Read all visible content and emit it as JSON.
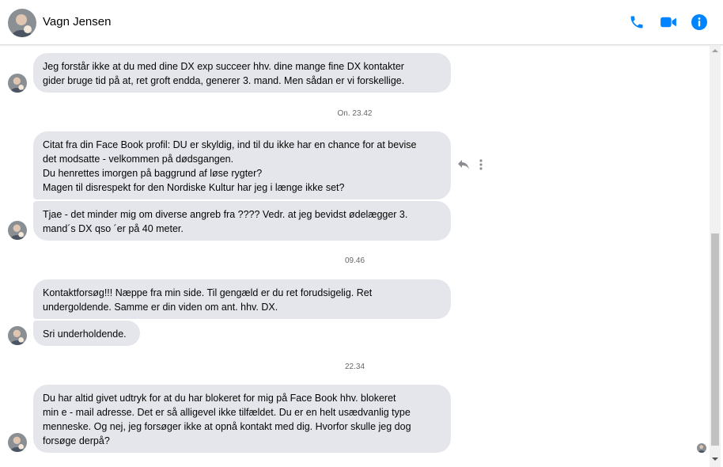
{
  "contact": {
    "name": "Vagn Jensen"
  },
  "header_icons": [
    "phone-icon",
    "video-camera-icon",
    "info-icon"
  ],
  "colors": {
    "accent": "#0084ff",
    "bubble": "#e4e6eb",
    "timestamp": "#65676b"
  },
  "messages": [
    {
      "text": "Jeg forstår ikke at du med dine DX exp succeer hhv. dine mange fine DX kontakter\ngider bruge tid på at, ret groft endda, generer 3. mand. Men sådan er vi forskellige."
    },
    {
      "text": "Citat fra din Face Book profil: DU er skyldig, ind til du ikke har en chance for at bevise\ndet modsatte - velkommen på dødsgangen.\nDu henrettes imorgen på baggrund af løse rygter?\nMagen til disrespekt for den Nordiske Kultur har jeg i længe ikke set?"
    },
    {
      "text": "Tjae - det minder mig om diverse angreb fra ???? Vedr. at jeg bevidst ødelægger 3.\nmand´s DX qso ´er på 40 meter."
    },
    {
      "text": "Kontaktforsøg!!! Næppe fra min side. Til gengæld er du ret forudsigelig. Ret\nundergoldende. Samme er din viden om ant. hhv. DX."
    },
    {
      "text": "Sri underholdende."
    },
    {
      "text": "Du har altid givet udtryk for at du har blokeret for mig på Face Book hhv. blokeret\nmin e - mail adresse. Det er så alligevel ikke tilfældet.  Du er en helt usædvanlig type\nmenneske. Og nej, jeg forsøger ikke at opnå kontakt med dig. Hvorfor skulle jeg dog\nforsøge derpå?"
    }
  ],
  "timestamps": [
    "On. 23.42",
    "09.46",
    "22.34"
  ],
  "message_actions": [
    "reply-icon",
    "more-options-icon"
  ]
}
